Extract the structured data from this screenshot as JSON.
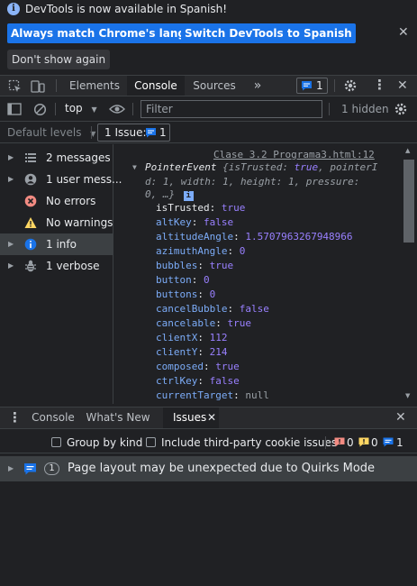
{
  "infobar": {
    "message": "DevTools is now available in Spanish!",
    "match_button": "Always match Chrome's language",
    "switch_button": "Switch DevTools to Spanish",
    "dont_show": "Don't show again"
  },
  "tabs": {
    "elements": "Elements",
    "console": "Console",
    "sources": "Sources",
    "more": "»",
    "issues_count": "1"
  },
  "toolbar": {
    "context": "top",
    "filter_placeholder": "Filter",
    "hidden": "1 hidden",
    "levels": "Default levels",
    "issue_label": "1 Issue:",
    "issue_count": "1"
  },
  "sidebar": {
    "items": [
      {
        "label": "2 messages"
      },
      {
        "label": "1 user mess..."
      },
      {
        "label": "No errors"
      },
      {
        "label": "No warnings"
      },
      {
        "label": "1 info"
      },
      {
        "label": "1 verbose"
      }
    ]
  },
  "console": {
    "source_link": "Clase 3.2 Programa3.html:12",
    "object_name": "PointerEvent",
    "summary_line1_a": "{isTrusted: ",
    "summary_line1_b": "true",
    "summary_line1_c": ", pointerI",
    "summary_line2": "d: 1, width: 1, height: 1, pressure:",
    "summary_line3": "0, …}",
    "props": [
      {
        "key": "isTrusted",
        "value": "true",
        "type": "bool",
        "highlight": true
      },
      {
        "key": "altKey",
        "value": "false",
        "type": "plain"
      },
      {
        "key": "altitudeAngle",
        "value": "1.5707963267948966",
        "type": "num"
      },
      {
        "key": "azimuthAngle",
        "value": "0",
        "type": "num"
      },
      {
        "key": "bubbles",
        "value": "true",
        "type": "plain"
      },
      {
        "key": "button",
        "value": "0",
        "type": "num"
      },
      {
        "key": "buttons",
        "value": "0",
        "type": "num"
      },
      {
        "key": "cancelBubble",
        "value": "false",
        "type": "plain"
      },
      {
        "key": "cancelable",
        "value": "true",
        "type": "plain"
      },
      {
        "key": "clientX",
        "value": "112",
        "type": "num"
      },
      {
        "key": "clientY",
        "value": "214",
        "type": "num"
      },
      {
        "key": "composed",
        "value": "true",
        "type": "plain"
      },
      {
        "key": "ctrlKey",
        "value": "false",
        "type": "plain"
      },
      {
        "key": "currentTarget",
        "value": "null",
        "type": "null"
      }
    ]
  },
  "drawer": {
    "console_tab": "Console",
    "whats_new_tab": "What's New",
    "issues_tab": "Issues",
    "group_by_kind": "Group by kind",
    "third_party": "Include third-party cookie issues",
    "err_count": "0",
    "warn_count": "0",
    "info_count": "1",
    "issue_badge": "1",
    "issue_text": "Page layout may be unexpected due to Quirks Mode"
  },
  "colors": {
    "accent": "#1a73e8",
    "background": "#202124",
    "selected": "#3c4043"
  }
}
